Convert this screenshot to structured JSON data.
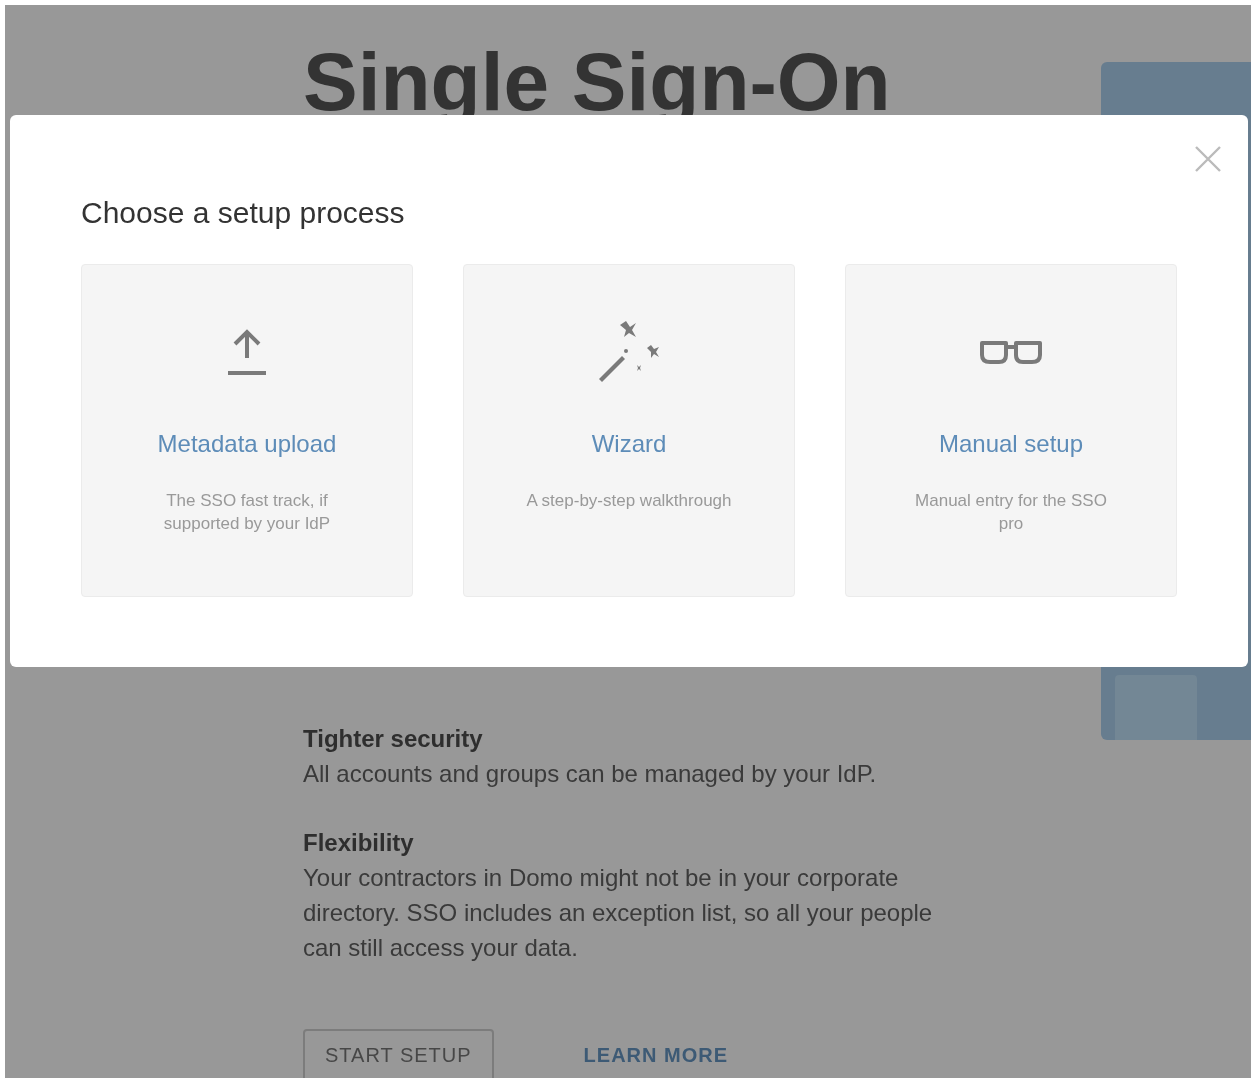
{
  "page": {
    "heading": "Single Sign-On",
    "features": [
      {
        "title": "Tighter security",
        "text": "All accounts and groups can be managed by your IdP."
      },
      {
        "title": "Flexibility",
        "text": "Your contractors in Domo might not be in your corporate directory. SSO includes an exception list, so all your people can still access your data."
      }
    ],
    "start_button": "START SETUP",
    "learn_link": "LEARN MORE"
  },
  "modal": {
    "title": "Choose a setup process",
    "options": [
      {
        "kind": "upload",
        "title": "Metadata upload",
        "description": "The SSO fast track, if supported by your IdP"
      },
      {
        "kind": "wizard",
        "title": "Wizard",
        "description": "A step-by-step walkthrough"
      },
      {
        "kind": "manual",
        "title": "Manual setup",
        "description": "Manual entry for the SSO pro"
      }
    ]
  }
}
